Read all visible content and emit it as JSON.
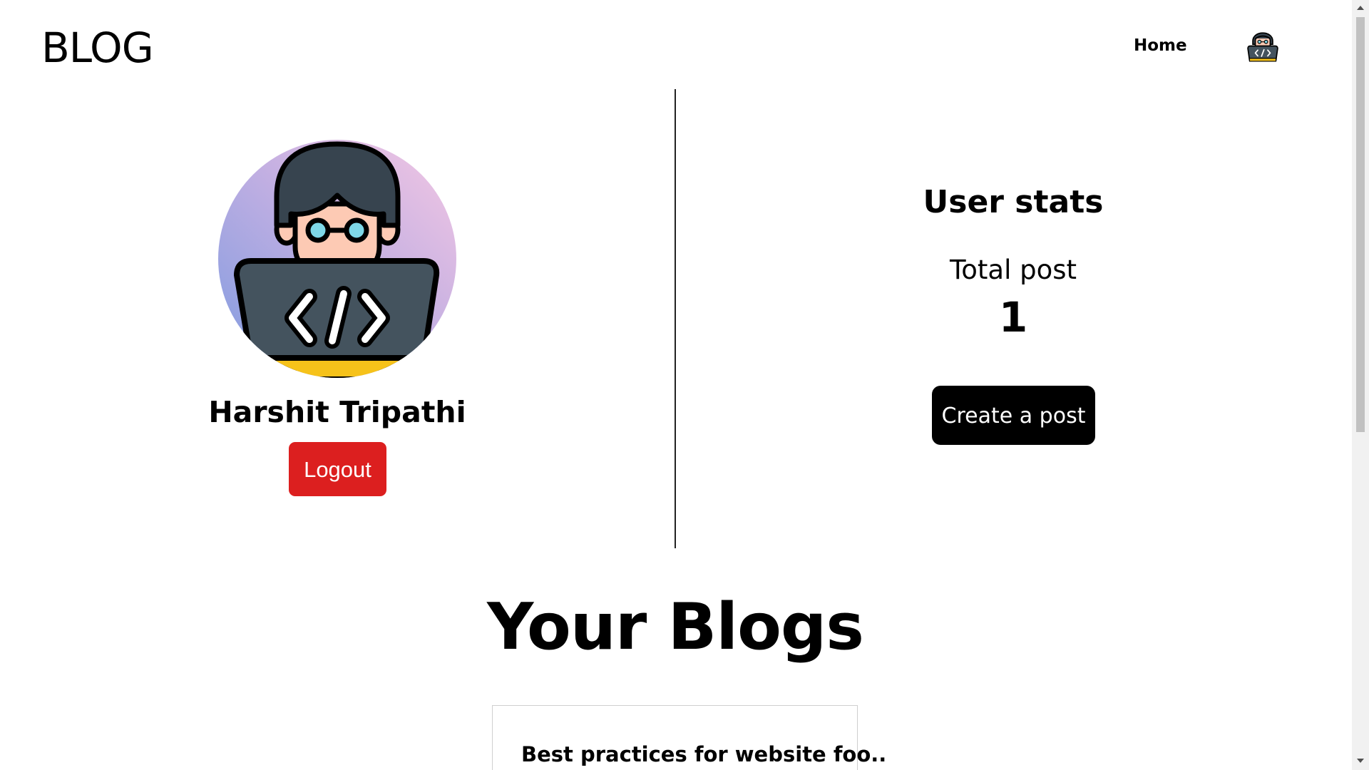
{
  "header": {
    "brand": "BLOG",
    "nav_home": "Home",
    "avatar_icon": "developer-avatar-icon"
  },
  "profile": {
    "name": "Harshit Tripathi",
    "logout_label": "Logout",
    "avatar_icon": "developer-avatar-icon"
  },
  "stats": {
    "title": "User stats",
    "total_post_label": "Total post",
    "total_post_value": "1",
    "create_label": "Create a post"
  },
  "blogs": {
    "heading": "Your Blogs",
    "items": [
      {
        "title": "Best practices for website foo.."
      }
    ]
  },
  "colors": {
    "logout": "#dc1f1f",
    "create": "#000000",
    "avatar_gradient_start": "#7f9be0",
    "avatar_gradient_end": "#f0c4e4",
    "laptop": "#44535e",
    "hair": "#37444f",
    "skin": "#fdcab4",
    "glasses": "#7ed8e8",
    "accent_yellow": "#f6c21a"
  }
}
